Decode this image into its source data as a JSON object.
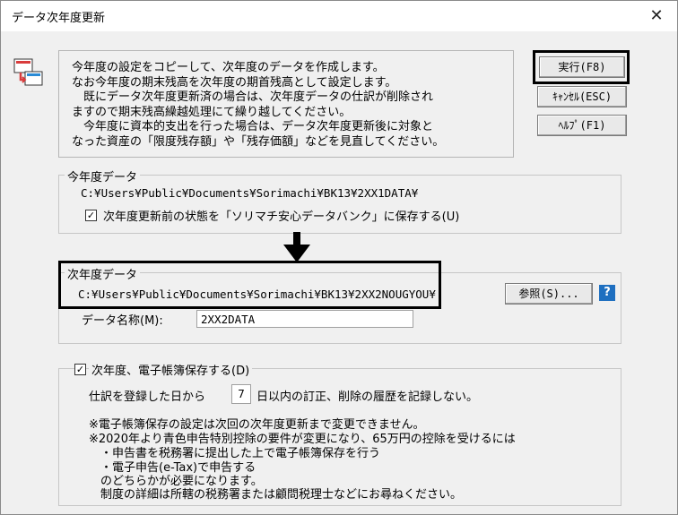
{
  "window": {
    "title": "データ次年度更新",
    "close_glyph": "✕"
  },
  "info": {
    "lines": [
      "今年度の設定をコピーして、次年度のデータを作成します。",
      "なお今年度の期末残高を次年度の期首残高として設定します。",
      "　既にデータ次年度更新済の場合は、次年度データの仕訳が削除され",
      "ますので期末残高繰越処理にて繰り越してください。",
      "　今年度に資本的支出を行った場合は、データ次年度更新後に対象と",
      "なった資産の「限度残存額」や「残存価額」などを見直してください。"
    ]
  },
  "buttons": {
    "execute": "実行(F8)",
    "cancel": "ｷｬﾝｾﾙ(ESC)",
    "help": "ﾍﾙﾌﾟ(F1)",
    "browse": "参照(S)..."
  },
  "current_year": {
    "legend": "今年度データ",
    "path": "C:¥Users¥Public¥Documents¥Sorimachi¥BK13¥2XX1DATA¥",
    "backup_checked": true,
    "backup_label": "次年度更新前の状態を「ソリマチ安心データバンク」に保存する(U)"
  },
  "next_year": {
    "legend": "次年度データ",
    "path": "C:¥Users¥Public¥Documents¥Sorimachi¥BK13¥2XX2NOUGYOU¥",
    "name_label": "データ名称(M):",
    "name_value": "2XX2DATA"
  },
  "ebook": {
    "checked": true,
    "label": "次年度、電子帳簿保存する(D)",
    "days_prefix": "仕訳を登録した日から",
    "days_value": "7",
    "days_suffix": "日以内の訂正、削除の履歴を記録しない。",
    "notes": [
      "※電子帳簿保存の設定は次回の次年度更新まで変更できません。",
      "※2020年より青色申告特別控除の要件が変更になり、65万円の控除を受けるには",
      "　・申告書を税務署に提出した上で電子帳簿保存を行う",
      "　・電子申告(e-Tax)で申告する",
      "　のどちらかが必要になります。",
      "　制度の詳細は所轄の税務署または顧問税理士などにお尋ねください。"
    ]
  },
  "help_icon_glyph": "?"
}
